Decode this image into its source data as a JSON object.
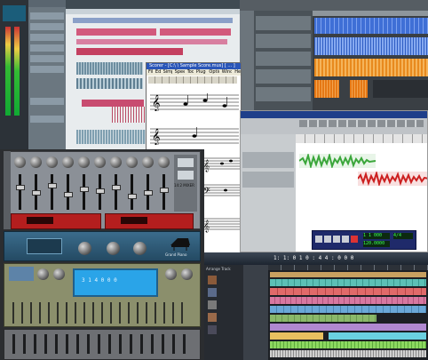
{
  "score_window": {
    "title": "Scorer - [C:\\ \\ Sample Score.mus] [ ... ]",
    "menu": [
      "File",
      "Edit",
      "Simple",
      "Speedy",
      "Tools",
      "Plug-ins",
      "Options",
      "Window",
      "Help"
    ]
  },
  "transport_panel": {
    "counter": "1 1 000",
    "tempo": "120.0000",
    "signature": "4/4"
  },
  "rack": {
    "mixer_label": "14:2 MIXER",
    "piano_label": "Grand Piano",
    "synth_display": "3 1 4 0 0 0"
  },
  "lower_right_daw": {
    "counter": "1: 1: 0 1 0 : 4 4 : 0 0 0",
    "track_list_header": "Arrange Track"
  },
  "colors": {
    "waveform_blue": "#3f6fd6",
    "waveform_orange": "#e88a1e",
    "clip_green": "#3aa63a",
    "clip_red": "#cc2020",
    "rack_red": "#b41e1e"
  }
}
